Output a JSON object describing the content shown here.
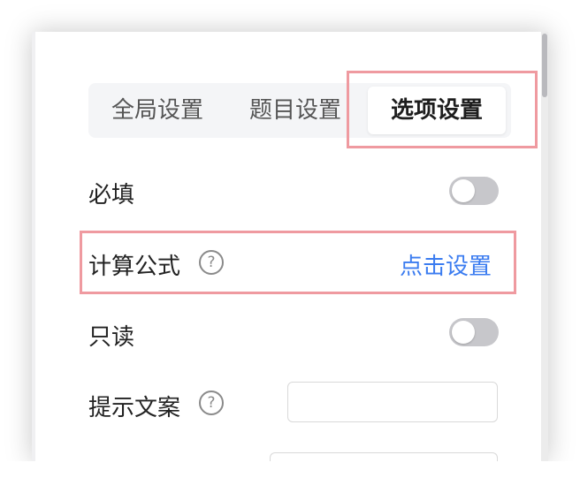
{
  "tabs": [
    {
      "label": "全局设置",
      "active": false
    },
    {
      "label": "题目设置",
      "active": false
    },
    {
      "label": "选项设置",
      "active": true
    }
  ],
  "fields": {
    "required": {
      "label": "必填",
      "toggle_on": false
    },
    "formula": {
      "label": "计算公式",
      "help_icon": "question-circle-icon",
      "action_label": "点击设置"
    },
    "readonly": {
      "label": "只读",
      "toggle_on": false
    },
    "hint": {
      "label": "提示文案",
      "help_icon": "question-circle-icon",
      "value": ""
    }
  },
  "colors": {
    "link": "#3b7cf0",
    "highlight": "#ef9aa0",
    "toggle_off": "#c7c7cb",
    "tab_bg": "#f4f5f7"
  }
}
